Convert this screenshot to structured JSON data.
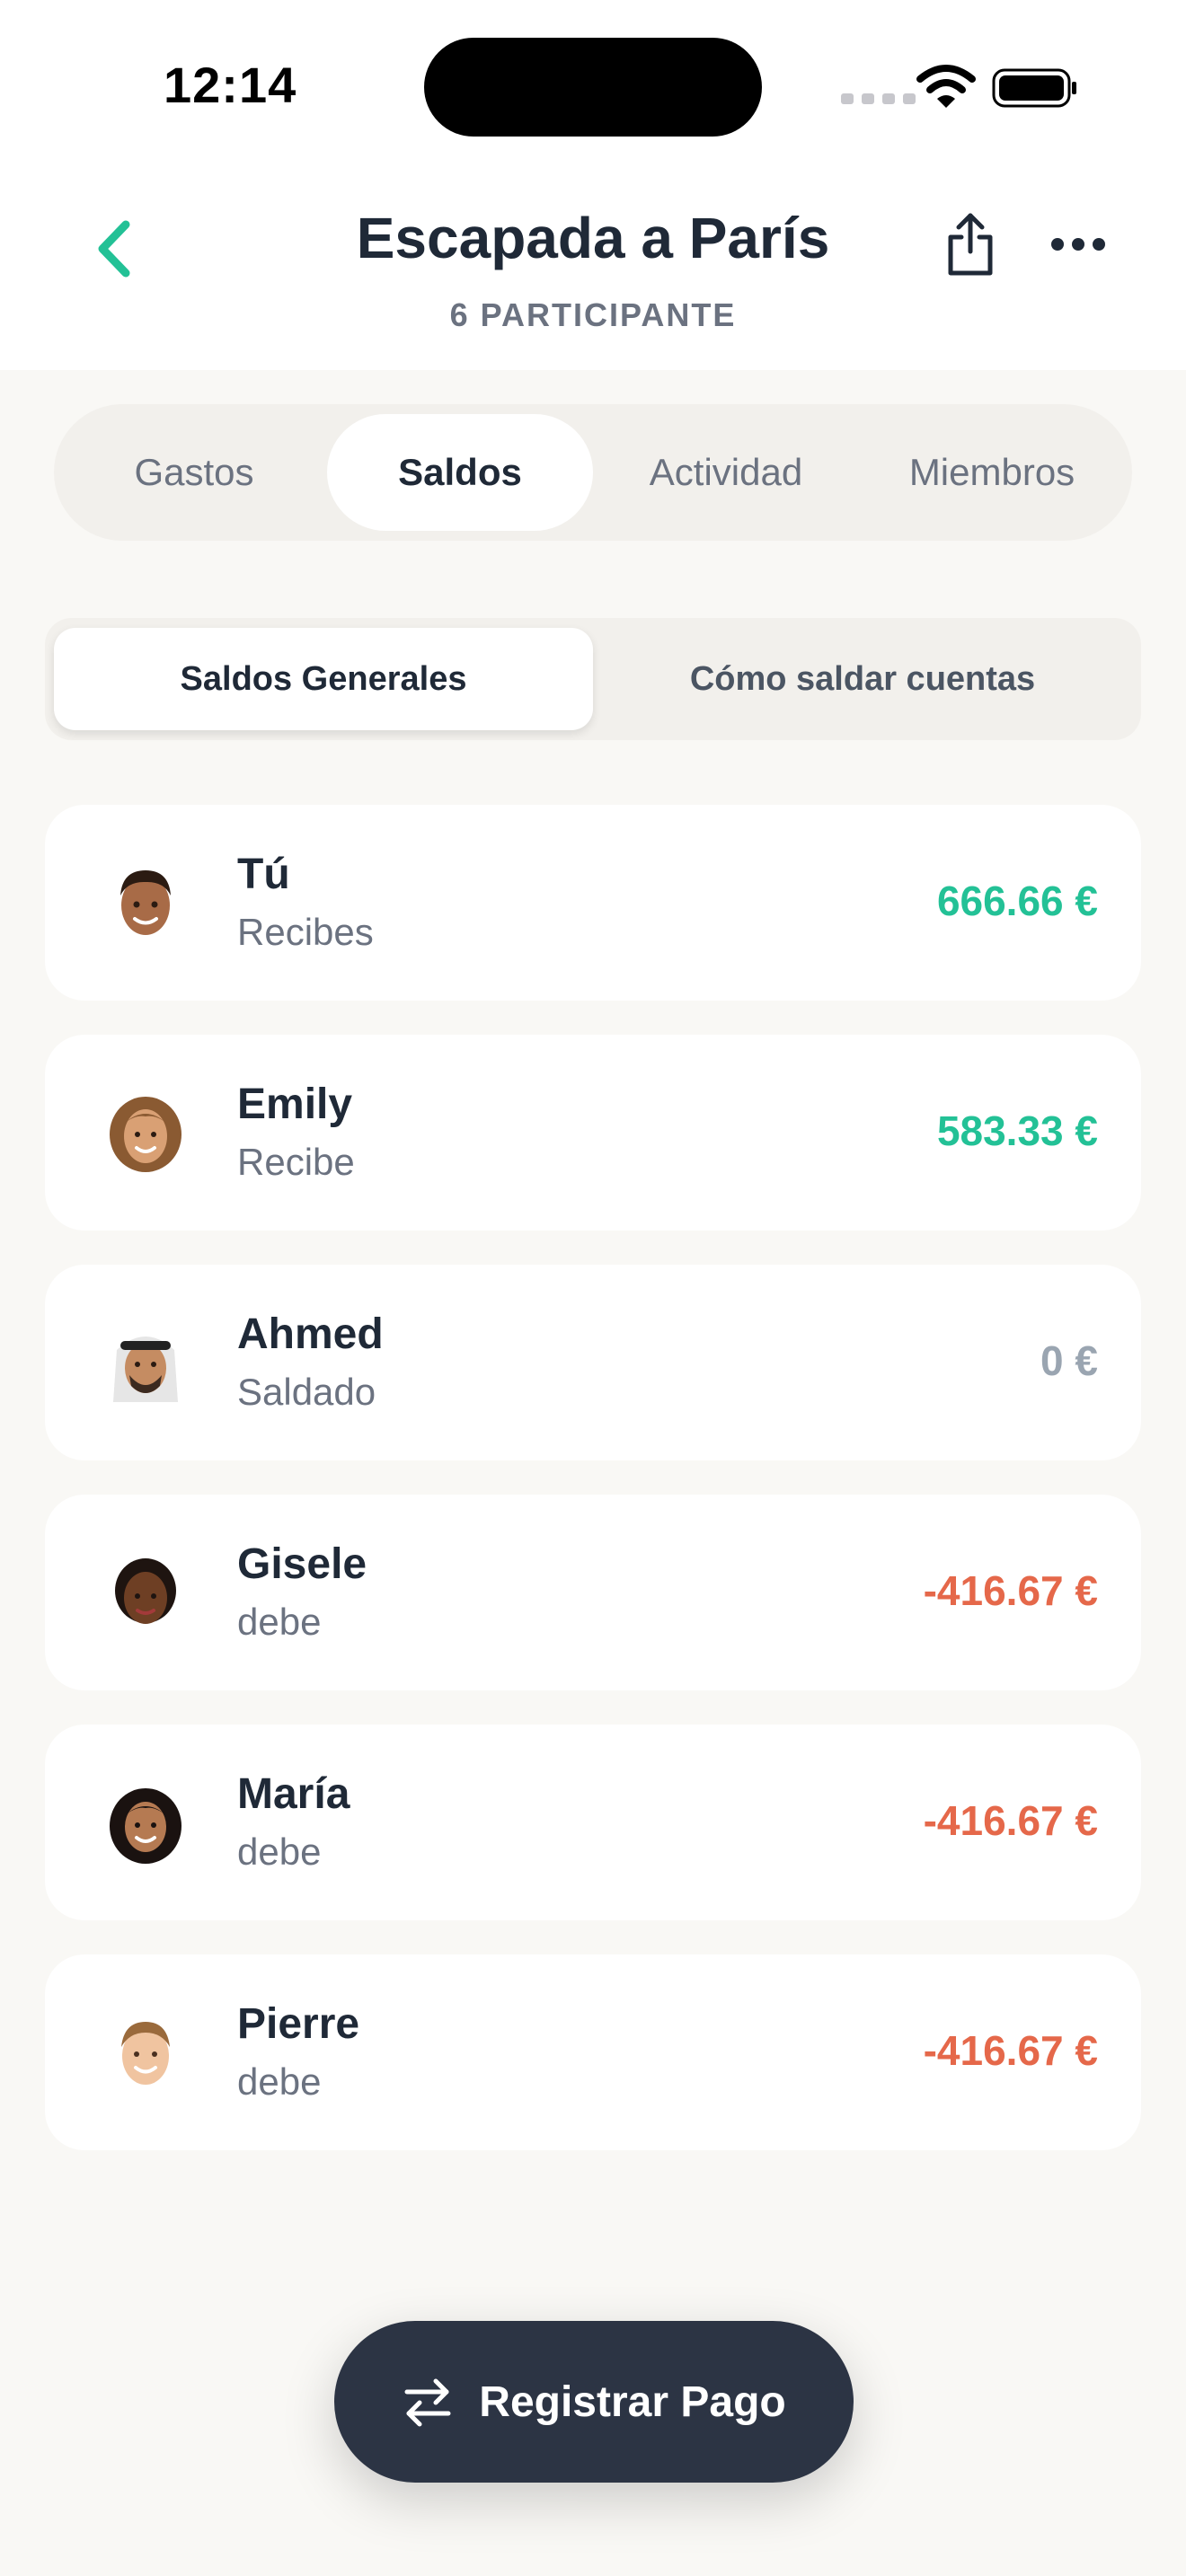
{
  "status_bar": {
    "time": "12:14"
  },
  "header": {
    "title": "Escapada a París",
    "subtitle": "6 PARTICIPANTE"
  },
  "tabs": [
    {
      "label": "Gastos",
      "active": false
    },
    {
      "label": "Saldos",
      "active": true
    },
    {
      "label": "Actividad",
      "active": false
    },
    {
      "label": "Miembros",
      "active": false
    }
  ],
  "segments": [
    {
      "label": "Saldos Generales",
      "active": true
    },
    {
      "label": "Cómo saldar cuentas",
      "active": false
    }
  ],
  "balances": [
    {
      "name": "Tú",
      "status": "Recibes",
      "amount": "666.66 €",
      "kind": "positive"
    },
    {
      "name": "Emily",
      "status": "Recibe",
      "amount": "583.33 €",
      "kind": "positive"
    },
    {
      "name": "Ahmed",
      "status": "Saldado",
      "amount": "0 €",
      "kind": "zero"
    },
    {
      "name": "Gisele",
      "status": "debe",
      "amount": "-416.67 €",
      "kind": "negative"
    },
    {
      "name": "María",
      "status": "debe",
      "amount": "-416.67 €",
      "kind": "negative"
    },
    {
      "name": "Pierre",
      "status": "debe",
      "amount": "-416.67 €",
      "kind": "negative"
    }
  ],
  "fab": {
    "label": "Registrar Pago",
    "icon": "swap-arrows-icon"
  },
  "colors": {
    "accent": "#23c196",
    "positive": "#23c196",
    "neutral": "#9aa5b1",
    "negative": "#e5684a",
    "button_dark": "#2c3444"
  }
}
